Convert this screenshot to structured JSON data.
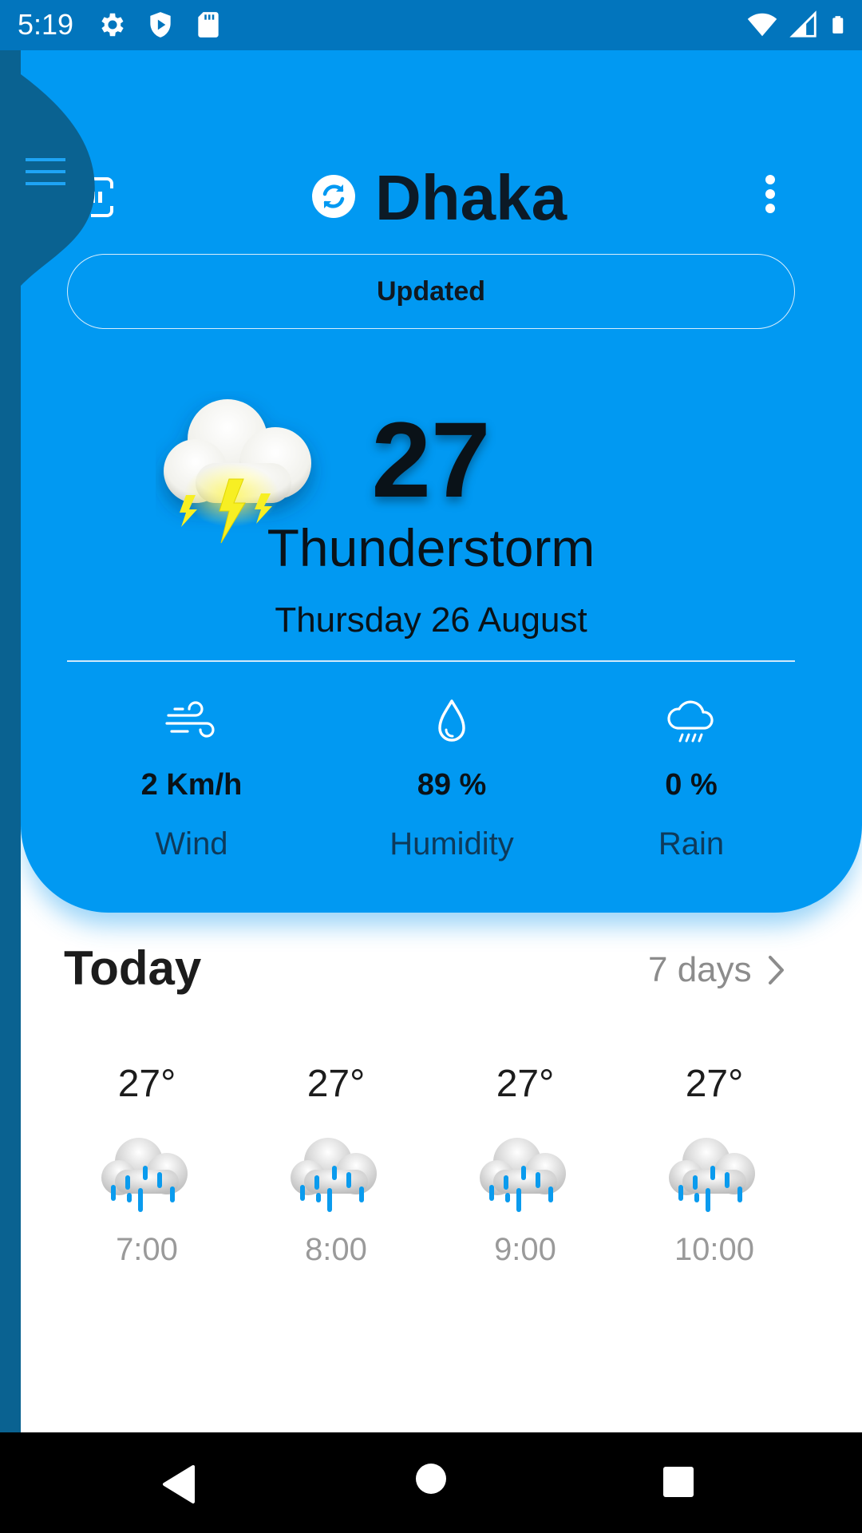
{
  "status_bar": {
    "time": "5:19",
    "left_icons": [
      "gear-icon",
      "shield-icon",
      "sd-card-icon"
    ],
    "right_icons": [
      "wifi-icon",
      "signal-icon",
      "battery-icon"
    ]
  },
  "header": {
    "city": "Dhaka",
    "update_status": "Updated"
  },
  "current": {
    "temperature": "27",
    "condition": "Thunderstorm",
    "date": "Thursday 26 August",
    "icon": "thunderstorm-cloud-icon"
  },
  "stats": [
    {
      "icon": "wind-icon",
      "value": "2 Km/h",
      "label": "Wind"
    },
    {
      "icon": "droplet-icon",
      "value": "89 %",
      "label": "Humidity"
    },
    {
      "icon": "rain-cloud-icon",
      "value": "0 %",
      "label": "Rain"
    }
  ],
  "today": {
    "title": "Today",
    "more_label": "7 days",
    "hours": [
      {
        "temp": "27°",
        "time": "7:00",
        "icon": "rain-cloud-icon"
      },
      {
        "temp": "27°",
        "time": "8:00",
        "icon": "rain-cloud-icon"
      },
      {
        "temp": "27°",
        "time": "9:00",
        "icon": "rain-cloud-icon"
      },
      {
        "temp": "27°",
        "time": "10:00",
        "icon": "rain-cloud-icon"
      }
    ]
  },
  "colors": {
    "hero": "#0199f2",
    "status_bar": "#0275bd",
    "drawer": "#0a6291"
  }
}
